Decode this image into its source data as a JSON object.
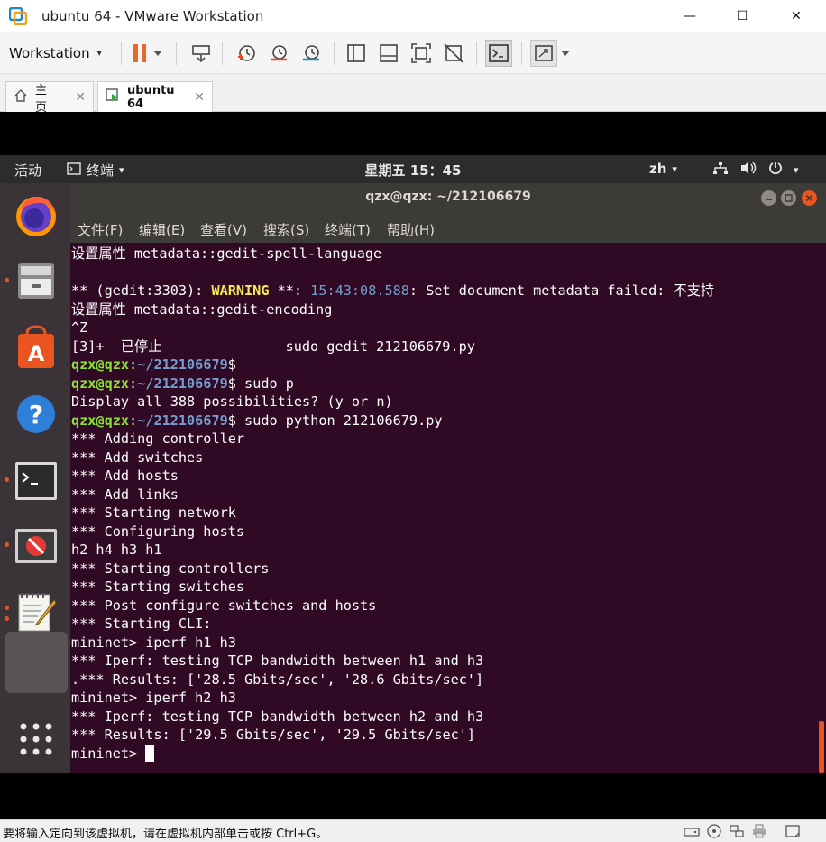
{
  "window": {
    "title": "ubuntu 64 - VMware Workstation",
    "minimize": "—",
    "maximize": "☐",
    "close": "✕"
  },
  "toolbar": {
    "menu_label": "Workstation",
    "menu_caret": "▾"
  },
  "tabs": [
    {
      "label": "主页",
      "close": "✕"
    },
    {
      "label": "ubuntu 64",
      "close": "✕"
    }
  ],
  "ubuntu": {
    "activities": "活动",
    "app_menu": "终端",
    "clock": "星期五 15：45",
    "lang": "zh",
    "caret": "▾"
  },
  "terminal": {
    "title": "qzx@qzx: ~/212106679",
    "menu": [
      "文件(F)",
      "编辑(E)",
      "查看(V)",
      "搜索(S)",
      "终端(T)",
      "帮助(H)"
    ],
    "lines": {
      "l1": "设置属性 metadata::gedit-spell-language",
      "l2": "",
      "l3a": "** (gedit:3303): ",
      "l3b": "WARNING",
      "l3c": " **: ",
      "l3d": "15:43:08.588",
      "l3e": ": Set document metadata failed: 不支持",
      "l4": "设置属性 metadata::gedit-encoding",
      "l5": "^Z",
      "l6": "[3]+  已停止               sudo gedit 212106679.py",
      "p1_user": "qzx@qzx",
      "p1_sep": ":",
      "p1_path": "~/212106679",
      "p1_cmd": "$",
      "p2_user": "qzx@qzx",
      "p2_sep": ":",
      "p2_path": "~/212106679",
      "p2_cmd": "$ sudo p",
      "l9": "Display all 388 possibilities? (y or n)",
      "p3_user": "qzx@qzx",
      "p3_sep": ":",
      "p3_path": "~/212106679",
      "p3_cmd": "$ sudo python 212106679.py",
      "l11": "*** Adding controller",
      "l12": "*** Add switches",
      "l13": "*** Add hosts",
      "l14": "*** Add links",
      "l15": "*** Starting network",
      "l16": "*** Configuring hosts",
      "l17": "h2 h4 h3 h1",
      "l18": "*** Starting controllers",
      "l19": "*** Starting switches",
      "l20": "*** Post configure switches and hosts",
      "l21": "*** Starting CLI:",
      "l22": "mininet> iperf h1 h3",
      "l23": "*** Iperf: testing TCP bandwidth between h1 and h3",
      "l24": ".*** Results: ['28.5 Gbits/sec', '28.6 Gbits/sec']",
      "l25": "mininet> iperf h2 h3",
      "l26": "*** Iperf: testing TCP bandwidth between h2 and h3",
      "l27": "*** Results: ['29.5 Gbits/sec', '29.5 Gbits/sec']",
      "l28": "mininet> "
    }
  },
  "statusbar": {
    "text": "要将输入定向到该虚拟机，请在虚拟机内部单击或按 Ctrl+G。"
  },
  "colors": {
    "terminal_bg": "#300a24",
    "prompt_green": "#8ae234",
    "path_blue": "#729fcf",
    "warning_yellow": "#fce94f",
    "ubuntu_orange": "#e95420"
  }
}
